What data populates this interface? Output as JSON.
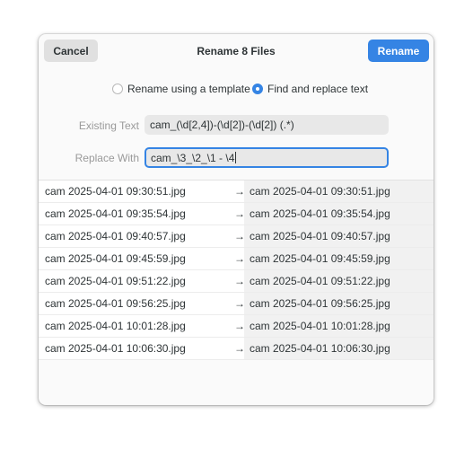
{
  "header": {
    "cancel_label": "Cancel",
    "title": "Rename 8 Files",
    "rename_label": "Rename"
  },
  "mode": {
    "template_label": "Rename using a template",
    "find_replace_label": "Find and replace text",
    "selected": "find_replace"
  },
  "fields": {
    "existing_label": "Existing Text",
    "existing_value": "cam_(\\d[2,4])-(\\d[2])-(\\d[2]) (.*)",
    "replace_label": "Replace With",
    "replace_value": "cam_\\3_\\2_\\1 - \\4"
  },
  "rows": [
    {
      "old": "cam 2025-04-01 09:30:51.jpg",
      "arrow": "→",
      "new": "cam 2025-04-01 09:30:51.jpg"
    },
    {
      "old": "cam 2025-04-01 09:35:54.jpg",
      "arrow": "→",
      "new": "cam 2025-04-01 09:35:54.jpg"
    },
    {
      "old": "cam 2025-04-01 09:40:57.jpg",
      "arrow": "→",
      "new": "cam 2025-04-01 09:40:57.jpg"
    },
    {
      "old": "cam 2025-04-01 09:45:59.jpg",
      "arrow": "→",
      "new": "cam 2025-04-01 09:45:59.jpg"
    },
    {
      "old": "cam 2025-04-01 09:51:22.jpg",
      "arrow": "→",
      "new": "cam 2025-04-01 09:51:22.jpg"
    },
    {
      "old": "cam 2025-04-01 09:56:25.jpg",
      "arrow": "→",
      "new": "cam 2025-04-01 09:56:25.jpg"
    },
    {
      "old": "cam 2025-04-01 10:01:28.jpg",
      "arrow": "→",
      "new": "cam 2025-04-01 10:01:28.jpg"
    },
    {
      "old": "cam 2025-04-01 10:06:30.jpg",
      "arrow": "→",
      "new": "cam 2025-04-01 10:06:30.jpg"
    }
  ],
  "colors": {
    "accent": "#3584e4",
    "dialog_bg": "#fafafa",
    "field_bg": "#e8e8e8"
  }
}
